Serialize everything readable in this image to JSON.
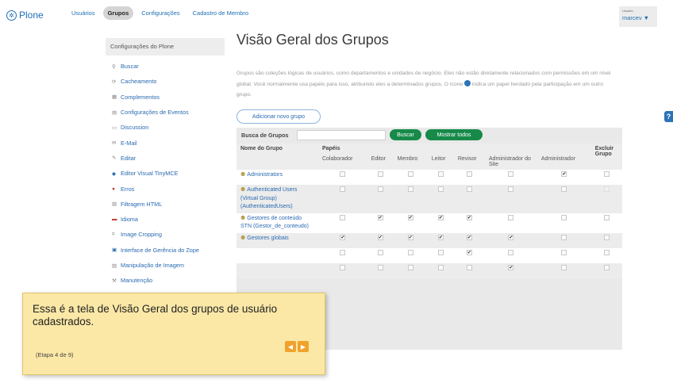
{
  "topbar": {
    "logo": "Plone",
    "nav": [
      "Usuários",
      "Grupos",
      "Configurações",
      "Cadastro de Membro"
    ],
    "user_caption": "Usuário",
    "user_name": "marcev ▼"
  },
  "sidebar": {
    "heading": "Configurações do Plone",
    "items": [
      {
        "icon": "search-icon",
        "label": "Buscar"
      },
      {
        "icon": "cache-icon",
        "label": "Cacheamento"
      },
      {
        "icon": "addons-icon",
        "label": "Complementos"
      },
      {
        "icon": "calendar-icon",
        "label": "Configurações de Eventos"
      },
      {
        "icon": "discussion-icon",
        "label": "Discussion"
      },
      {
        "icon": "mail-icon",
        "label": "E-Mail"
      },
      {
        "icon": "edit-icon",
        "label": "Editar"
      },
      {
        "icon": "editor-icon",
        "label": "Editor Visual TinyMCE"
      },
      {
        "icon": "error-icon",
        "label": "Erros"
      },
      {
        "icon": "filter-icon",
        "label": "Filtragem HTML"
      },
      {
        "icon": "language-icon",
        "label": "Idioma"
      },
      {
        "icon": "crop-icon",
        "label": "Image Cropping"
      },
      {
        "icon": "zope-icon",
        "label": "Interface de Gerência do Zope"
      },
      {
        "icon": "image-icon",
        "label": "Manipulação de Imagem"
      },
      {
        "icon": "maintenance-icon",
        "label": "Manutenção"
      }
    ]
  },
  "main": {
    "title": "Visão Geral dos Grupos",
    "description_1": "Grupos são coleções lógicas de usuários, como departamentos e unidades de negócio. Eles não estão diretamente",
    "description_2": "relacionados com permissões em um nível global. Você normalmente usa papéis para isso, atribuindo eles a",
    "description_3a": "determinados grupos. O ícone",
    "description_3b": "indica um papel herdado pela participação em um outro grupo.",
    "add_group_label": "Adicionar novo grupo",
    "search_label": "Busca de Grupos",
    "search_value": "",
    "search_button": "Buscar",
    "show_all_button": "Mostrar todos"
  },
  "table": {
    "col_group_name": "Nome do Grupo",
    "col_roles": "Papéis",
    "col_delete": "Excluir Grupo",
    "roles": [
      "Colaborador",
      "Editor",
      "Membro",
      "Leitor",
      "Revisor",
      "Administrador do Site",
      "Administrador"
    ],
    "rows": [
      {
        "name": "Administrators",
        "checks": [
          0,
          0,
          0,
          0,
          0,
          0,
          1
        ],
        "delete": 0
      },
      {
        "name": "Authenticated Users (Virtual Group) (AuthenticatedUsers)",
        "checks": [
          0,
          0,
          0,
          0,
          0,
          0,
          0
        ],
        "delete": 0
      },
      {
        "name": "Gestores de conteúdo STN (Gestor_de_conteudo)",
        "checks": [
          0,
          1,
          1,
          1,
          1,
          0,
          0
        ],
        "delete": 0
      },
      {
        "name": "Gestores globais",
        "checks": [
          1,
          1,
          1,
          1,
          1,
          1,
          0
        ],
        "delete": 0
      },
      {
        "name": "",
        "checks": [
          0,
          0,
          0,
          0,
          1,
          0,
          0
        ],
        "delete": 0
      },
      {
        "name": "",
        "checks": [
          0,
          0,
          0,
          0,
          0,
          1,
          0
        ],
        "delete": 0
      }
    ]
  },
  "popup": {
    "message": "Essa é a tela de Visão Geral dos grupos de usuário cadastrados.",
    "step": "(Etapa 4 de 9)",
    "prev": "◀",
    "next": "▶"
  }
}
